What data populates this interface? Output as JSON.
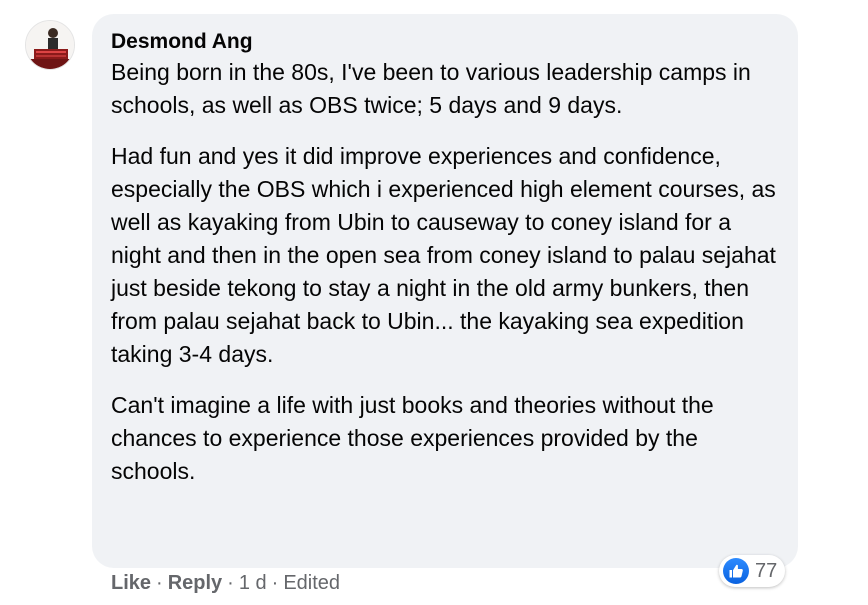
{
  "comment": {
    "author": "Desmond Ang",
    "paragraphs": [
      "Being born in the 80s, I've been to various leadership camps in schools, as well as OBS twice; 5 days and 9 days.",
      "Had fun and yes it did improve experiences and confidence, especially the OBS which i experienced high element courses, as well as kayaking from Ubin to causeway to coney island for a night and then in the open sea from coney island to palau sejahat just beside tekong to stay a night in the old army bunkers, then from palau sejahat back to Ubin... the kayaking sea expedition taking 3-4 days.",
      "Can't imagine a life with just books and theories without the chances to experience those experiences provided by the schools."
    ],
    "reactions": {
      "icon": "like-thumb-icon",
      "count": "77"
    }
  },
  "actions": {
    "like_label": "Like",
    "reply_label": "Reply",
    "separator": "·",
    "time": "1 d",
    "edited_label": "Edited"
  },
  "colors": {
    "bubble_bg": "#f0f2f5",
    "text": "#050505",
    "meta": "#65676b",
    "like_blue": "#1877f2"
  }
}
